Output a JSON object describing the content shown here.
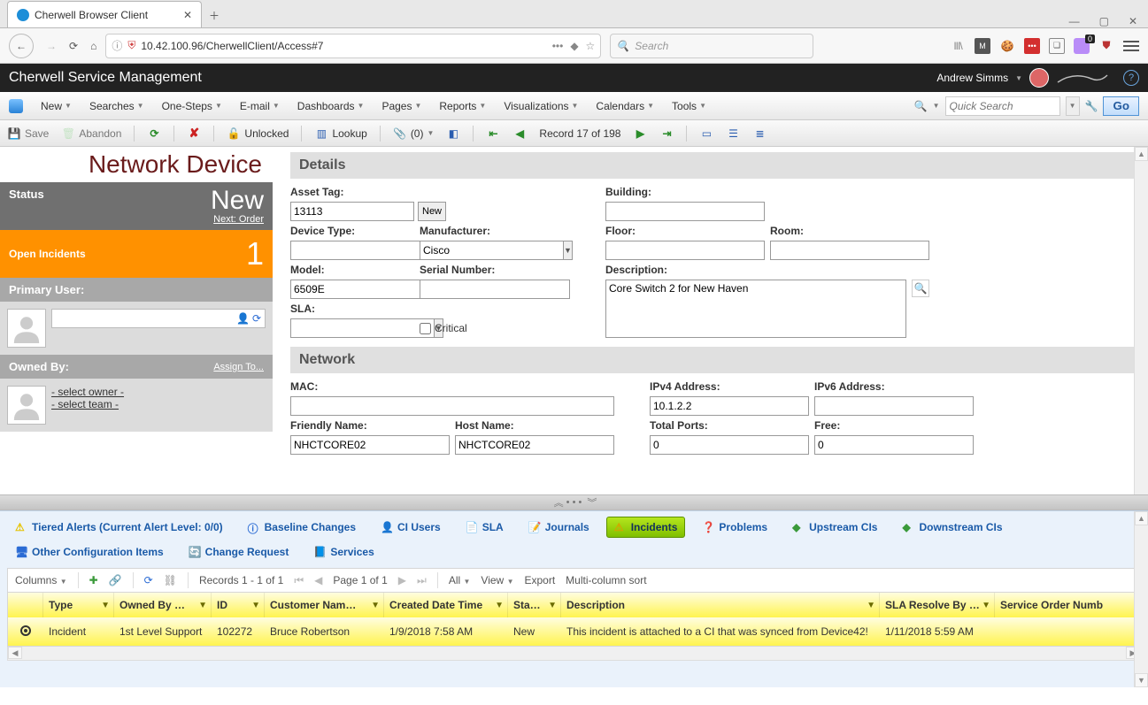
{
  "browser": {
    "tab_title": "Cherwell Browser Client",
    "url": "10.42.100.96/CherwellClient/Access#7",
    "search_placeholder": "Search"
  },
  "app": {
    "title": "Cherwell Service Management",
    "user": "Andrew Simms"
  },
  "menu": [
    "New",
    "Searches",
    "One-Steps",
    "E-mail",
    "Dashboards",
    "Pages",
    "Reports",
    "Visualizations",
    "Calendars",
    "Tools"
  ],
  "quick_search": {
    "placeholder": "Quick Search",
    "go": "Go"
  },
  "toolbar": {
    "save": "Save",
    "abandon": "Abandon",
    "unlocked": "Unlocked",
    "lookup": "Lookup",
    "attach_count": "(0)",
    "record_pos": "Record 17 of 198"
  },
  "record": {
    "type_title": "Network Device",
    "status_label": "Status",
    "status_value": "New",
    "next": "Next: Order",
    "open_incidents_label": "Open Incidents",
    "open_incidents_count": "1",
    "primary_user_label": "Primary User:",
    "owned_by_label": "Owned By:",
    "assign_to": "Assign To...",
    "select_owner": "- select owner -",
    "select_team": "- select team -"
  },
  "details": {
    "section": "Details",
    "asset_tag_label": "Asset Tag:",
    "asset_tag": "13113",
    "new_btn": "New",
    "building_label": "Building:",
    "building": "",
    "device_type_label": "Device Type:",
    "device_type": "",
    "manufacturer_label": "Manufacturer:",
    "manufacturer": "Cisco",
    "floor_label": "Floor:",
    "floor": "",
    "room_label": "Room:",
    "room": "",
    "model_label": "Model:",
    "model": "6509E",
    "serial_label": "Serial Number:",
    "serial": "",
    "description_label": "Description:",
    "description": "Core Switch 2 for New Haven",
    "sla_label": "SLA:",
    "sla": "",
    "critical_label": "Critical"
  },
  "network": {
    "section": "Network",
    "mac_label": "MAC:",
    "mac": "",
    "ipv4_label": "IPv4 Address:",
    "ipv4": "10.1.2.2",
    "ipv6_label": "IPv6 Address:",
    "ipv6": "",
    "friendly_label": "Friendly Name:",
    "friendly": "NHCTCORE02",
    "host_label": "Host Name:",
    "host": "NHCTCORE02",
    "ports_label": "Total Ports:",
    "ports": "0",
    "free_label": "Free:",
    "free": "0"
  },
  "bottom_tabs": {
    "tiered": "Tiered Alerts (Current Alert Level: 0/0)",
    "baseline": "Baseline Changes",
    "ci_users": "CI Users",
    "sla": "SLA",
    "journals": "Journals",
    "incidents": "Incidents",
    "problems": "Problems",
    "upstream": "Upstream CIs",
    "downstream": "Downstream CIs",
    "other": "Other Configuration Items",
    "change": "Change Request",
    "services": "Services"
  },
  "grid_toolbar": {
    "columns": "Columns",
    "records": "Records  1 - 1  of  1",
    "page": "Page  1  of  1",
    "all": "All",
    "view": "View",
    "export": "Export",
    "multisort": "Multi-column sort"
  },
  "grid": {
    "headers": {
      "type": "Type",
      "owned": "Owned By …",
      "id": "ID",
      "customer": "Customer Nam…",
      "created": "Created Date Time",
      "status": "Sta…",
      "desc": "Description",
      "sla": "SLA Resolve By …",
      "service": "Service Order Numb"
    },
    "row": {
      "type": "Incident",
      "owned": "1st Level Support",
      "id": "102272",
      "customer": "Bruce Robertson",
      "created": "1/9/2018 7:58 AM",
      "status": "New",
      "desc": "This incident is attached to a CI that was synced from Device42!",
      "sla": "1/11/2018 5:59 AM",
      "service": ""
    }
  }
}
